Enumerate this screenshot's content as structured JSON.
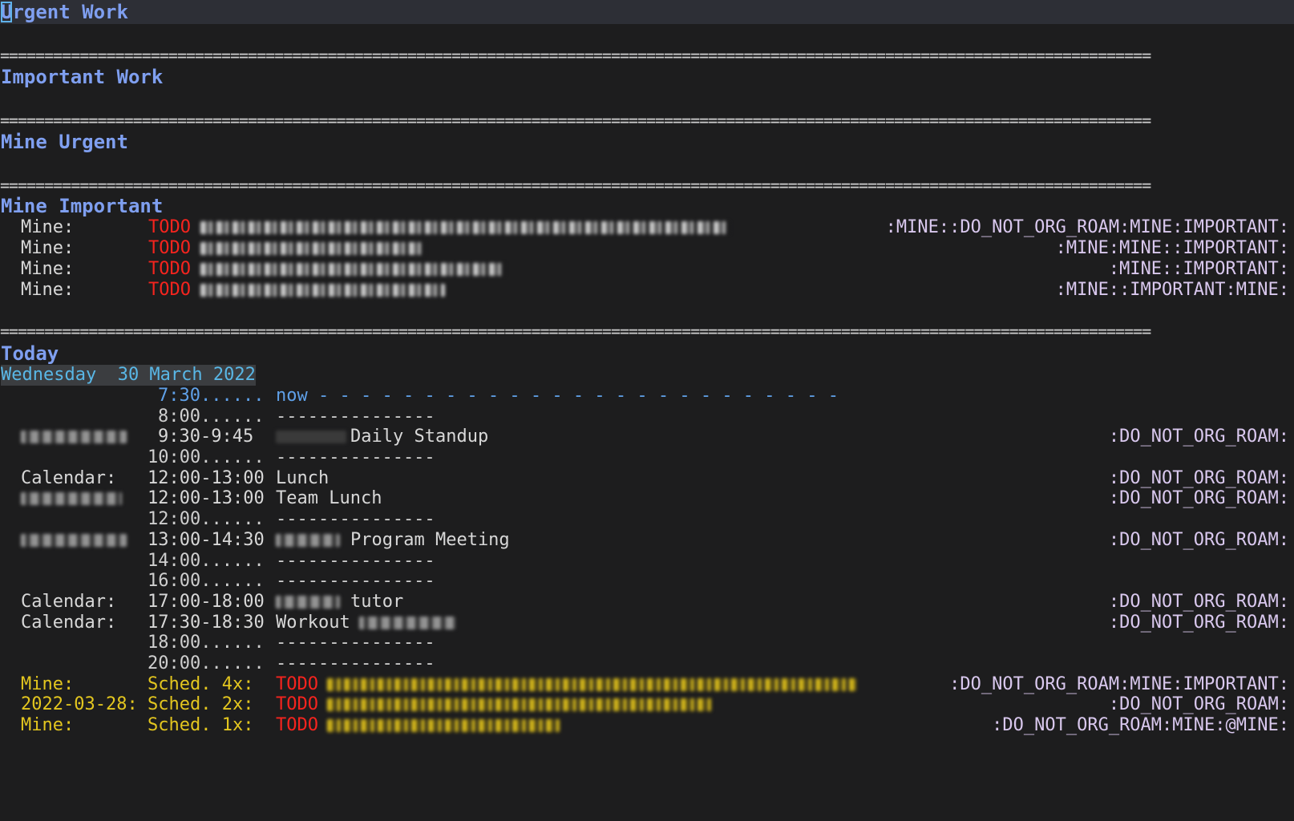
{
  "sections": {
    "urgent_work": "Urgent Work",
    "important_work": "Important Work",
    "mine_urgent": "Mine Urgent",
    "mine_important": "Mine Important",
    "today": "Today"
  },
  "separator": "==================================================================================================================================",
  "mine_important": [
    {
      "category": "Mine:",
      "keyword": "TODO",
      "tags": ":MINE::DO_NOT_ORG_ROAM:MINE:IMPORTANT:"
    },
    {
      "category": "Mine:",
      "keyword": "TODO",
      "tags": ":MINE:MINE::IMPORTANT:"
    },
    {
      "category": "Mine:",
      "keyword": "TODO",
      "tags": ":MINE::IMPORTANT:"
    },
    {
      "category": "Mine:",
      "keyword": "TODO",
      "tags": ":MINE::IMPORTANT:MINE:"
    }
  ],
  "agenda": {
    "date": "Wednesday  30 March 2022",
    "now_time": "7:30......",
    "now_label": "now",
    "now_line": "- - - - - - - - - - - - - - - - - - - - - - - - -",
    "grid_line": "---------------",
    "grid_times": {
      "t800": "8:00......",
      "t1000": "10:00......",
      "t1200": "12:00......",
      "t1400": "14:00......",
      "t1600": "16:00......",
      "t1800": "18:00......",
      "t2000": "20:00......"
    },
    "events": [
      {
        "category": "",
        "time": "9:30-9:45",
        "title": "Daily Standup",
        "tags": ":DO_NOT_ORG_ROAM:"
      },
      {
        "category": "Calendar:",
        "time": "12:00-13:00",
        "title": "Lunch",
        "tags": ":DO_NOT_ORG_ROAM:"
      },
      {
        "category": "",
        "time": "12:00-13:00",
        "title": "Team Lunch",
        "tags": ":DO_NOT_ORG_ROAM:"
      },
      {
        "category": "",
        "time": "13:00-14:30",
        "title": "Program Meeting",
        "tags": ":DO_NOT_ORG_ROAM:"
      },
      {
        "category": "Calendar:",
        "time": "17:00-18:00",
        "title": "tutor",
        "tags": ":DO_NOT_ORG_ROAM:"
      },
      {
        "category": "Calendar:",
        "time": "17:30-18:30",
        "title": "Workout",
        "tags": ":DO_NOT_ORG_ROAM:"
      }
    ],
    "scheduled": [
      {
        "category": "Mine:",
        "sched": "Sched. 4x:",
        "keyword": "TODO",
        "tags": ":DO_NOT_ORG_ROAM:MINE:IMPORTANT:"
      },
      {
        "category": "2022-03-28:",
        "sched": "Sched. 2x:",
        "keyword": "TODO",
        "tags": ":DO_NOT_ORG_ROAM:"
      },
      {
        "category": "Mine:",
        "sched": "Sched. 1x:",
        "keyword": "TODO",
        "tags": ":DO_NOT_ORG_ROAM:MINE:@MINE:"
      }
    ]
  },
  "colors": {
    "background": "#1d1d1e",
    "header": "#7f9ff0",
    "todo": "#f5241e",
    "scheduled": "#e3c61f",
    "tags": "#d9c8ee",
    "date": "#59b7e6",
    "now": "#5fa0e8"
  }
}
